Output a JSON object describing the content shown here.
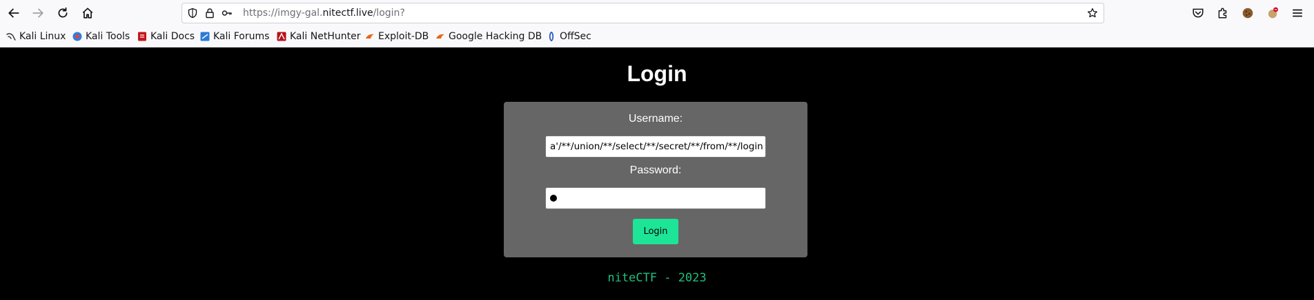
{
  "browser": {
    "url_prefix": "https://imgy-gal.",
    "url_host": "nitectf.live",
    "url_path": "/login?"
  },
  "bookmarks": [
    {
      "label": "Kali Linux",
      "icon": "kali-dragon-icon"
    },
    {
      "label": "Kali Tools",
      "icon": "kali-tools-icon"
    },
    {
      "label": "Kali Docs",
      "icon": "kali-docs-icon"
    },
    {
      "label": "Kali Forums",
      "icon": "kali-forums-icon"
    },
    {
      "label": "Kali NetHunter",
      "icon": "kali-nethunter-icon"
    },
    {
      "label": "Exploit-DB",
      "icon": "exploit-db-icon"
    },
    {
      "label": "Google Hacking DB",
      "icon": "ghdb-icon"
    },
    {
      "label": "OffSec",
      "icon": "offsec-icon"
    }
  ],
  "page": {
    "title": "Login",
    "username_label": "Username:",
    "username_value": "a'/**/union/**/select/**/secret/**/from/**/login",
    "password_label": "Password:",
    "password_value": "●",
    "login_button": "Login",
    "footer": "niteCTF - 2023"
  },
  "colors": {
    "page_bg": "#000000",
    "card_bg": "#666666",
    "button_bg": "#1de597",
    "footer_text": "#20c07e"
  }
}
